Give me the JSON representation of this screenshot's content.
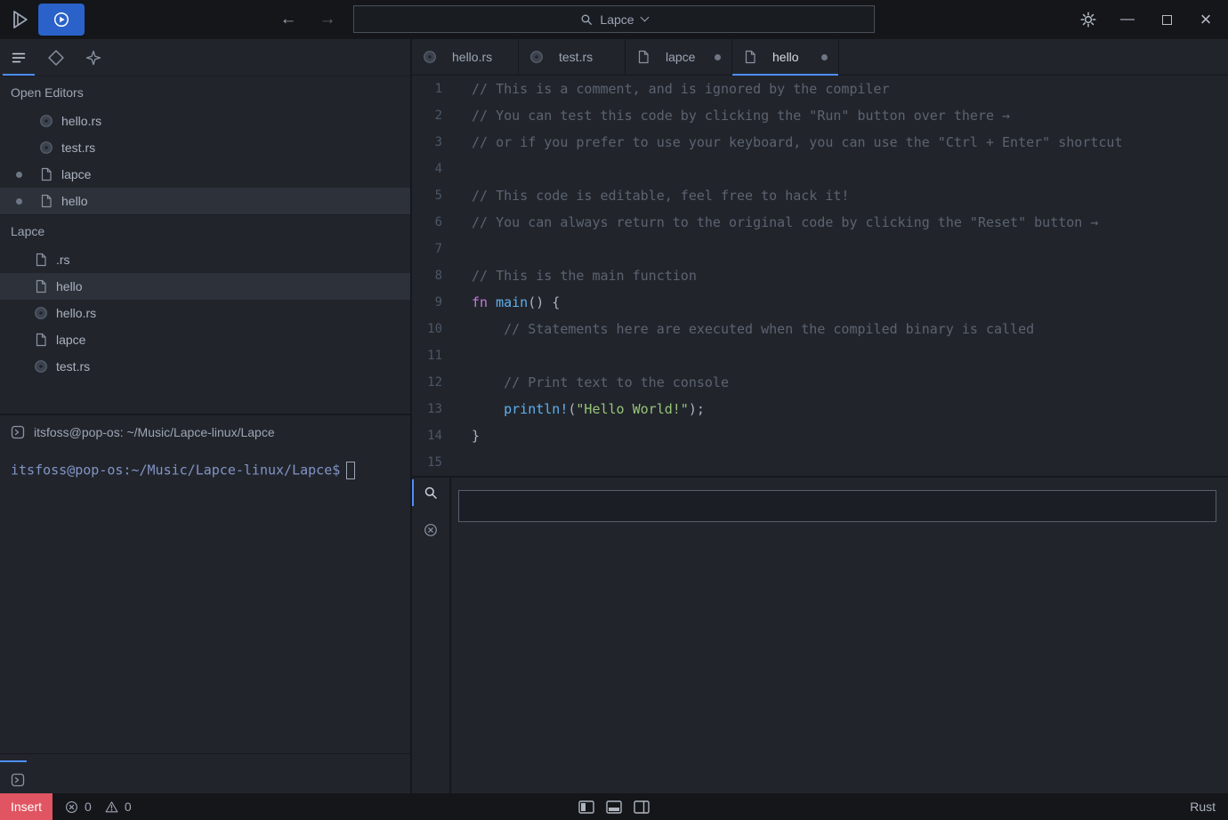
{
  "icons": {
    "back": "←",
    "forward": "→",
    "minimize": "—",
    "close": "×",
    "lapce-logo": "svg-play-triangle",
    "remote-connection": "svg-circle-play",
    "search": "svg-magnifier",
    "chevron-down": "css-chevron",
    "gear": "svg-gear",
    "maximize": "css-square",
    "file-explorer": "svg-list-lines",
    "source-control": "svg-diamond",
    "plugins": "svg-star",
    "rust-file": "svg-dark-circle",
    "file": "svg-document",
    "terminal": "svg-rounded-square-caret",
    "problems": "svg-circle-x",
    "error": "svg-circle-x",
    "warning": "svg-triangle-exclamation",
    "layout-left": "svg-panel-left",
    "layout-bottom": "svg-panel-bottom",
    "layout-right": "svg-panel-right"
  },
  "colors": {
    "accent": "#4d8ef7",
    "remote_button": "#2a62c9",
    "insert_badge": "#e05561",
    "comment": "#5c6370",
    "keyword": "#c678dd",
    "function": "#61afef",
    "string": "#98c379"
  },
  "titlebar": {
    "palette_label": "Lapce"
  },
  "sidebar": {
    "open_editors": {
      "header": "Open Editors",
      "items": [
        {
          "label": "hello.rs",
          "icon": "rust",
          "modified": false,
          "selected": false
        },
        {
          "label": "test.rs",
          "icon": "rust",
          "modified": false,
          "selected": false
        },
        {
          "label": "lapce",
          "icon": "file",
          "modified": true,
          "selected": false
        },
        {
          "label": "hello",
          "icon": "file",
          "modified": true,
          "selected": true
        }
      ]
    },
    "workspace": {
      "header": "Lapce",
      "items": [
        {
          "label": ".rs",
          "icon": "file",
          "selected": false
        },
        {
          "label": "hello",
          "icon": "file",
          "selected": true
        },
        {
          "label": "hello.rs",
          "icon": "rust",
          "selected": false
        },
        {
          "label": "lapce",
          "icon": "file",
          "selected": false
        },
        {
          "label": "test.rs",
          "icon": "rust",
          "selected": false
        }
      ]
    }
  },
  "terminal": {
    "title": "itsfoss@pop-os: ~/Music/Lapce-linux/Lapce",
    "prompt": "itsfoss@pop-os:~/Music/Lapce-linux/Lapce$"
  },
  "editor": {
    "tabs": [
      {
        "label": "hello.rs",
        "icon": "rust",
        "modified": false,
        "active": false
      },
      {
        "label": "test.rs",
        "icon": "rust",
        "modified": false,
        "active": false
      },
      {
        "label": "lapce",
        "icon": "file",
        "modified": true,
        "active": false
      },
      {
        "label": "hello",
        "icon": "file",
        "modified": true,
        "active": true
      }
    ],
    "lines": [
      {
        "num": "1",
        "segments": [
          {
            "type": "comment",
            "text": "// This is a comment, and is ignored by the compiler"
          }
        ]
      },
      {
        "num": "2",
        "segments": [
          {
            "type": "comment",
            "text": "// You can test this code by clicking the \"Run\" button over there →"
          }
        ]
      },
      {
        "num": "3",
        "segments": [
          {
            "type": "comment",
            "text": "// or if you prefer to use your keyboard, you can use the \"Ctrl + Enter\" shortcut"
          }
        ]
      },
      {
        "num": "4",
        "segments": []
      },
      {
        "num": "5",
        "segments": [
          {
            "type": "comment",
            "text": "// This code is editable, feel free to hack it!"
          }
        ]
      },
      {
        "num": "6",
        "segments": [
          {
            "type": "comment",
            "text": "// You can always return to the original code by clicking the \"Reset\" button →"
          }
        ]
      },
      {
        "num": "7",
        "segments": []
      },
      {
        "num": "8",
        "segments": [
          {
            "type": "comment",
            "text": "// This is the main function"
          }
        ]
      },
      {
        "num": "9",
        "segments": [
          {
            "type": "keyword",
            "text": "fn "
          },
          {
            "type": "function",
            "text": "main"
          },
          {
            "type": "plain",
            "text": "() {"
          }
        ]
      },
      {
        "num": "10",
        "segments": [
          {
            "type": "comment",
            "text": "    // Statements here are executed when the compiled binary is called"
          }
        ]
      },
      {
        "num": "11",
        "segments": []
      },
      {
        "num": "12",
        "segments": [
          {
            "type": "comment",
            "text": "    // Print text to the console"
          }
        ]
      },
      {
        "num": "13",
        "segments": [
          {
            "type": "plain",
            "text": "    "
          },
          {
            "type": "macro",
            "text": "println!"
          },
          {
            "type": "plain",
            "text": "("
          },
          {
            "type": "string",
            "text": "\"Hello World!\""
          },
          {
            "type": "plain",
            "text": ");"
          }
        ]
      },
      {
        "num": "14",
        "segments": [
          {
            "type": "plain",
            "text": "}"
          }
        ]
      },
      {
        "num": "15",
        "segments": []
      }
    ]
  },
  "panel": {
    "search_value": ""
  },
  "statusbar": {
    "mode": "Insert",
    "error_count": "0",
    "warning_count": "0",
    "language": "Rust"
  }
}
